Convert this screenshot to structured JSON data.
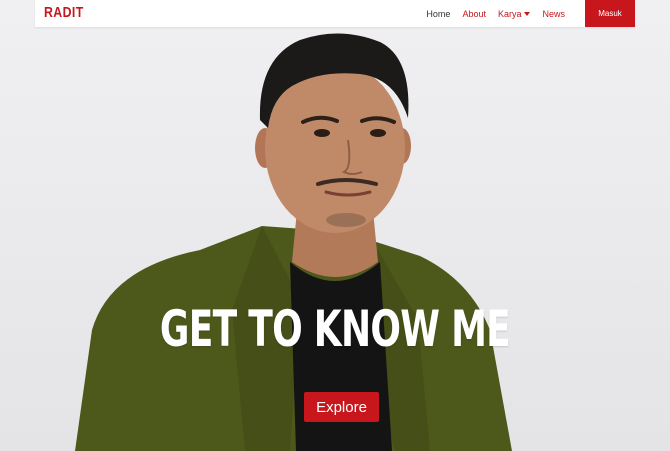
{
  "navbar": {
    "brand": "RADIT",
    "links": {
      "home": "Home",
      "about": "About",
      "karya": "Karya",
      "news": "News"
    },
    "login_label": "Masuk"
  },
  "hero": {
    "title": "GET TO KNOW ME",
    "button_label": "Explore"
  },
  "colors": {
    "brand_red": "#c7161c",
    "background": "#ececee",
    "jacket": "#4f5a1c"
  }
}
